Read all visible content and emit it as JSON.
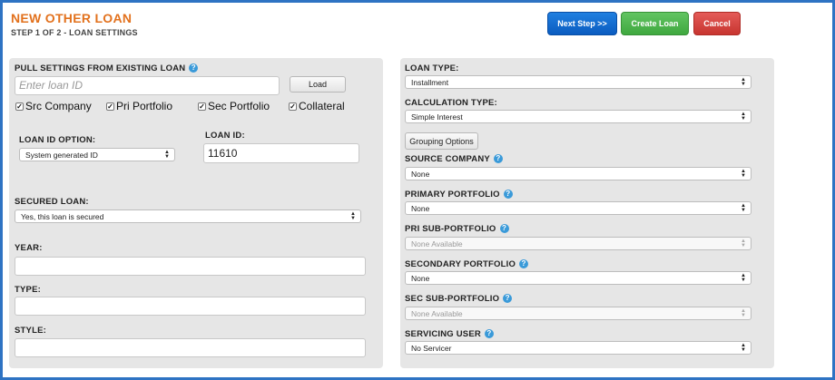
{
  "header": {
    "title": "NEW OTHER LOAN",
    "subtitle": "STEP 1 OF 2 - LOAN SETTINGS",
    "next_label": "Next Step >>",
    "create_label": "Create Loan",
    "cancel_label": "Cancel"
  },
  "left": {
    "pull_label": "PULL SETTINGS FROM EXISTING LOAN",
    "loan_id_placeholder": "Enter loan ID",
    "load_label": "Load",
    "checks": [
      "Src Company",
      "Pri Portfolio",
      "Sec Portfolio",
      "Collateral"
    ],
    "loan_id_option_label": "LOAN ID OPTION:",
    "loan_id_option_value": "System generated ID",
    "loan_id_label": "LOAN ID:",
    "loan_id_value": "11610",
    "secured_label": "SECURED LOAN:",
    "secured_value": "Yes, this loan is secured",
    "year_label": "YEAR:",
    "type_label": "TYPE:",
    "style_label": "STYLE:"
  },
  "right": {
    "loan_type_label": "LOAN TYPE:",
    "loan_type_value": "Installment",
    "calc_type_label": "CALCULATION TYPE:",
    "calc_type_value": "Simple Interest",
    "grouping_label": "Grouping Options",
    "source_company_label": "SOURCE COMPANY",
    "source_company_value": "None",
    "primary_portfolio_label": "PRIMARY PORTFOLIO",
    "primary_portfolio_value": "None",
    "pri_sub_label": "PRI SUB-PORTFOLIO",
    "pri_sub_value": "None Available",
    "secondary_portfolio_label": "SECONDARY PORTFOLIO",
    "secondary_portfolio_value": "None",
    "sec_sub_label": "SEC SUB-PORTFOLIO",
    "sec_sub_value": "None Available",
    "servicing_user_label": "SERVICING USER",
    "servicing_user_value": "No Servicer"
  },
  "icons": {
    "help": "help-icon",
    "checkmark": "checkmark-icon",
    "select_arrows": "select-arrows-icon"
  },
  "colors": {
    "title": "#e2711d",
    "frame": "#2e73c3",
    "next_button": "#1f7fe0",
    "create_button": "#4cb34c",
    "cancel_button": "#d4403c",
    "help": "#3a9ad9",
    "panel": "#e6e6e6"
  }
}
